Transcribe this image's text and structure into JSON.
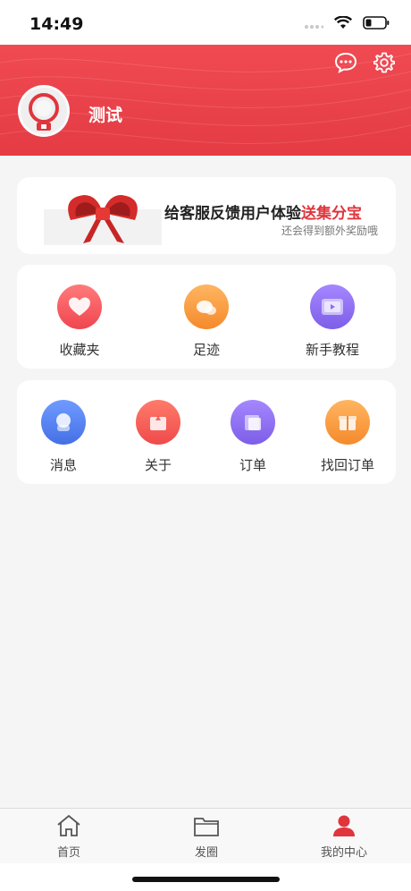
{
  "status": {
    "time": "14:49"
  },
  "profile": {
    "username": "测试"
  },
  "banner": {
    "title_main": "给客服反馈用户体验",
    "title_highlight": "送集分宝",
    "subtitle": "还会得到额外奖励哦"
  },
  "quick_row_1": [
    {
      "label": "收藏夹",
      "icon": "heart-icon",
      "color": "#f4555c"
    },
    {
      "label": "足迹",
      "icon": "footprint-icon",
      "color": "#f89a3c"
    },
    {
      "label": "新手教程",
      "icon": "video-icon",
      "color": "#8d6cf0"
    }
  ],
  "quick_row_2": [
    {
      "label": "消息",
      "icon": "message-icon",
      "color": "#4d7cf0"
    },
    {
      "label": "关于",
      "icon": "about-icon",
      "color": "#f4555c"
    },
    {
      "label": "订单",
      "icon": "order-icon",
      "color": "#8d6cf0"
    },
    {
      "label": "找回订单",
      "icon": "gift-box-icon",
      "color": "#f89a3c"
    }
  ],
  "tabbar": {
    "items": [
      {
        "label": "首页",
        "icon": "home-icon"
      },
      {
        "label": "发圈",
        "icon": "folder-icon"
      },
      {
        "label": "我的中心",
        "icon": "user-icon",
        "active": true
      }
    ],
    "active_color": "#e0353d"
  }
}
